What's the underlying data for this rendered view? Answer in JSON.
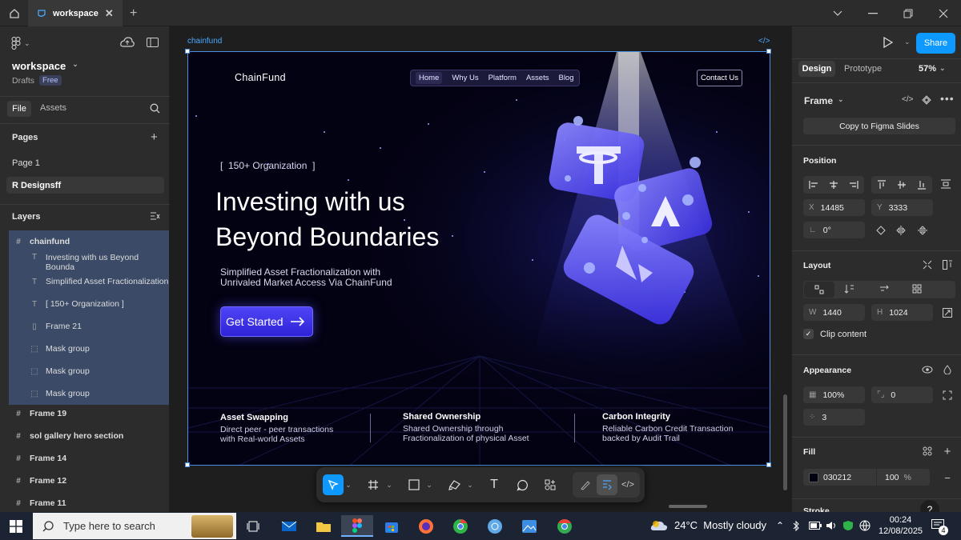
{
  "topbar": {
    "tab_title": "workspace"
  },
  "left": {
    "workspace": "workspace",
    "drafts": "Drafts",
    "plan": "Free",
    "tabs": [
      "File",
      "Assets"
    ],
    "pages_title": "Pages",
    "pages": [
      "Page 1",
      "R Designsff"
    ],
    "layers_title": "Layers",
    "layers": [
      {
        "label": "chainfund",
        "icon": "#"
      },
      {
        "label": "Investing with us Beyond Bounda",
        "icon": "T"
      },
      {
        "label": "Simplified Asset Fractionalization",
        "icon": "T"
      },
      {
        "label": "[ 150+ Organization ]",
        "icon": "T"
      },
      {
        "label": "Frame 21",
        "icon": "▯"
      },
      {
        "label": "Mask group",
        "icon": "⬚"
      },
      {
        "label": "Mask group",
        "icon": "⬚"
      },
      {
        "label": "Mask group",
        "icon": "⬚"
      },
      {
        "label": "Frame 19",
        "icon": "#"
      },
      {
        "label": "sol gallery hero section",
        "icon": "#"
      },
      {
        "label": "Frame 14",
        "icon": "#"
      },
      {
        "label": "Frame 12",
        "icon": "#"
      },
      {
        "label": "Frame 11",
        "icon": "#"
      }
    ]
  },
  "canvas": {
    "frame_label": "chainfund",
    "site": {
      "logo": "ChainFund",
      "nav": [
        "Home",
        "Why Us",
        "Platform",
        "Assets",
        "Blog"
      ],
      "contact": "Contact Us",
      "badge": "[  150+ Organization  ]",
      "headline_1": "Investing with us",
      "headline_2": "Beyond Boundaries",
      "sub_1": "Simplified Asset Fractionalization with",
      "sub_2": "Unrivaled Market Access Via ChainFund",
      "cta": "Get Started",
      "features": [
        {
          "title": "Asset Swapping",
          "line1": "Direct peer -  peer transactions",
          "line2": "with Real-world Assets"
        },
        {
          "title": "Shared Ownership",
          "line1": "Shared Ownership through",
          "line2": "Fractionalization of physical Asset"
        },
        {
          "title": "Carbon Integrity",
          "line1": "Reliable Carbon Credit Transaction",
          "line2": "backed by Audit Trail"
        }
      ]
    }
  },
  "right": {
    "share": "Share",
    "tabs": [
      "Design",
      "Prototype"
    ],
    "zoom": "57%",
    "frame_title": "Frame",
    "copy_btn": "Copy to Figma Slides",
    "position_title": "Position",
    "x_label": "X",
    "x": "14485",
    "y_label": "Y",
    "y": "3333",
    "rotation": "0°",
    "layout_title": "Layout",
    "w_label": "W",
    "w": "1440",
    "h_label": "H",
    "h": "1024",
    "clip": "Clip content",
    "appearance_title": "Appearance",
    "opacity": "100%",
    "radius": "0",
    "spacing": "3",
    "fill_title": "Fill",
    "fill_hex": "030212",
    "fill_opacity": "100",
    "fill_pct": "%",
    "stroke_title": "Stroke",
    "fill_color": "#030212",
    "accent": "#0d99ff"
  },
  "taskbar": {
    "search_placeholder": "Type here to search",
    "weather": "24°C  Mostly cloudy",
    "time": "00:24",
    "date": "12/08/2025",
    "notif": "4"
  }
}
